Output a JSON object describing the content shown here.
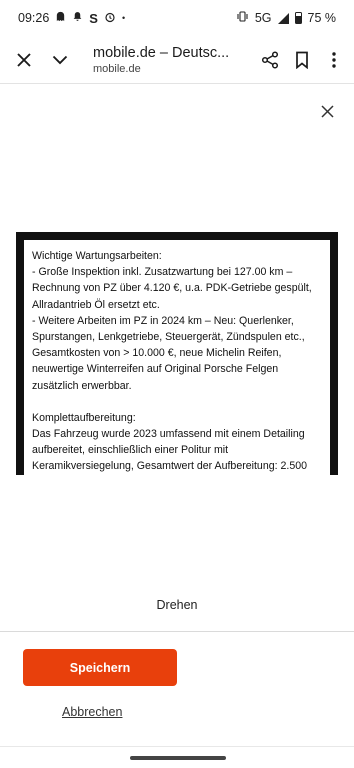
{
  "statusbar": {
    "time": "09:26",
    "s_icon": "S",
    "network": "5G",
    "battery": "75 %",
    "dot": "•"
  },
  "urlbar": {
    "title": "mobile.de – Deutsc...",
    "domain": "mobile.de"
  },
  "image_text": {
    "paragraph1": [
      "Wichtige Wartungsarbeiten:",
      "- Große Inspektion inkl. Zusatzwartung bei 127.00 km –",
      "Rechnung von PZ über 4.120 €, u.a. PDK-Getriebe gespült,",
      "Allradantrieb Öl ersetzt etc.",
      "- Weitere Arbeiten im PZ in 2024 km – Neu: Querlenker,",
      "Spurstangen, Lenkgetriebe, Steuergerät, Zündspulen etc.,",
      "Gesamtkosten von > 10.000 €, neue Michelin Reifen,",
      "neuwertige Winterreifen auf Original Porsche Felgen",
      "zusätzlich erwerbbar."
    ],
    "paragraph2": [
      "Komplettaufbereitung:",
      "Das Fahrzeug wurde 2023 umfassend mit einem Detailing",
      "aufbereitet, einschließlich einer Politur mit",
      "Keramikversiegelung, Gesamtwert der Aufbereitung: 2.500",
      "€"
    ]
  },
  "rotate_label": "Drehen",
  "save_label": "Speichern",
  "cancel_label": "Abbrechen",
  "colors": {
    "accent": "#e8400c"
  }
}
